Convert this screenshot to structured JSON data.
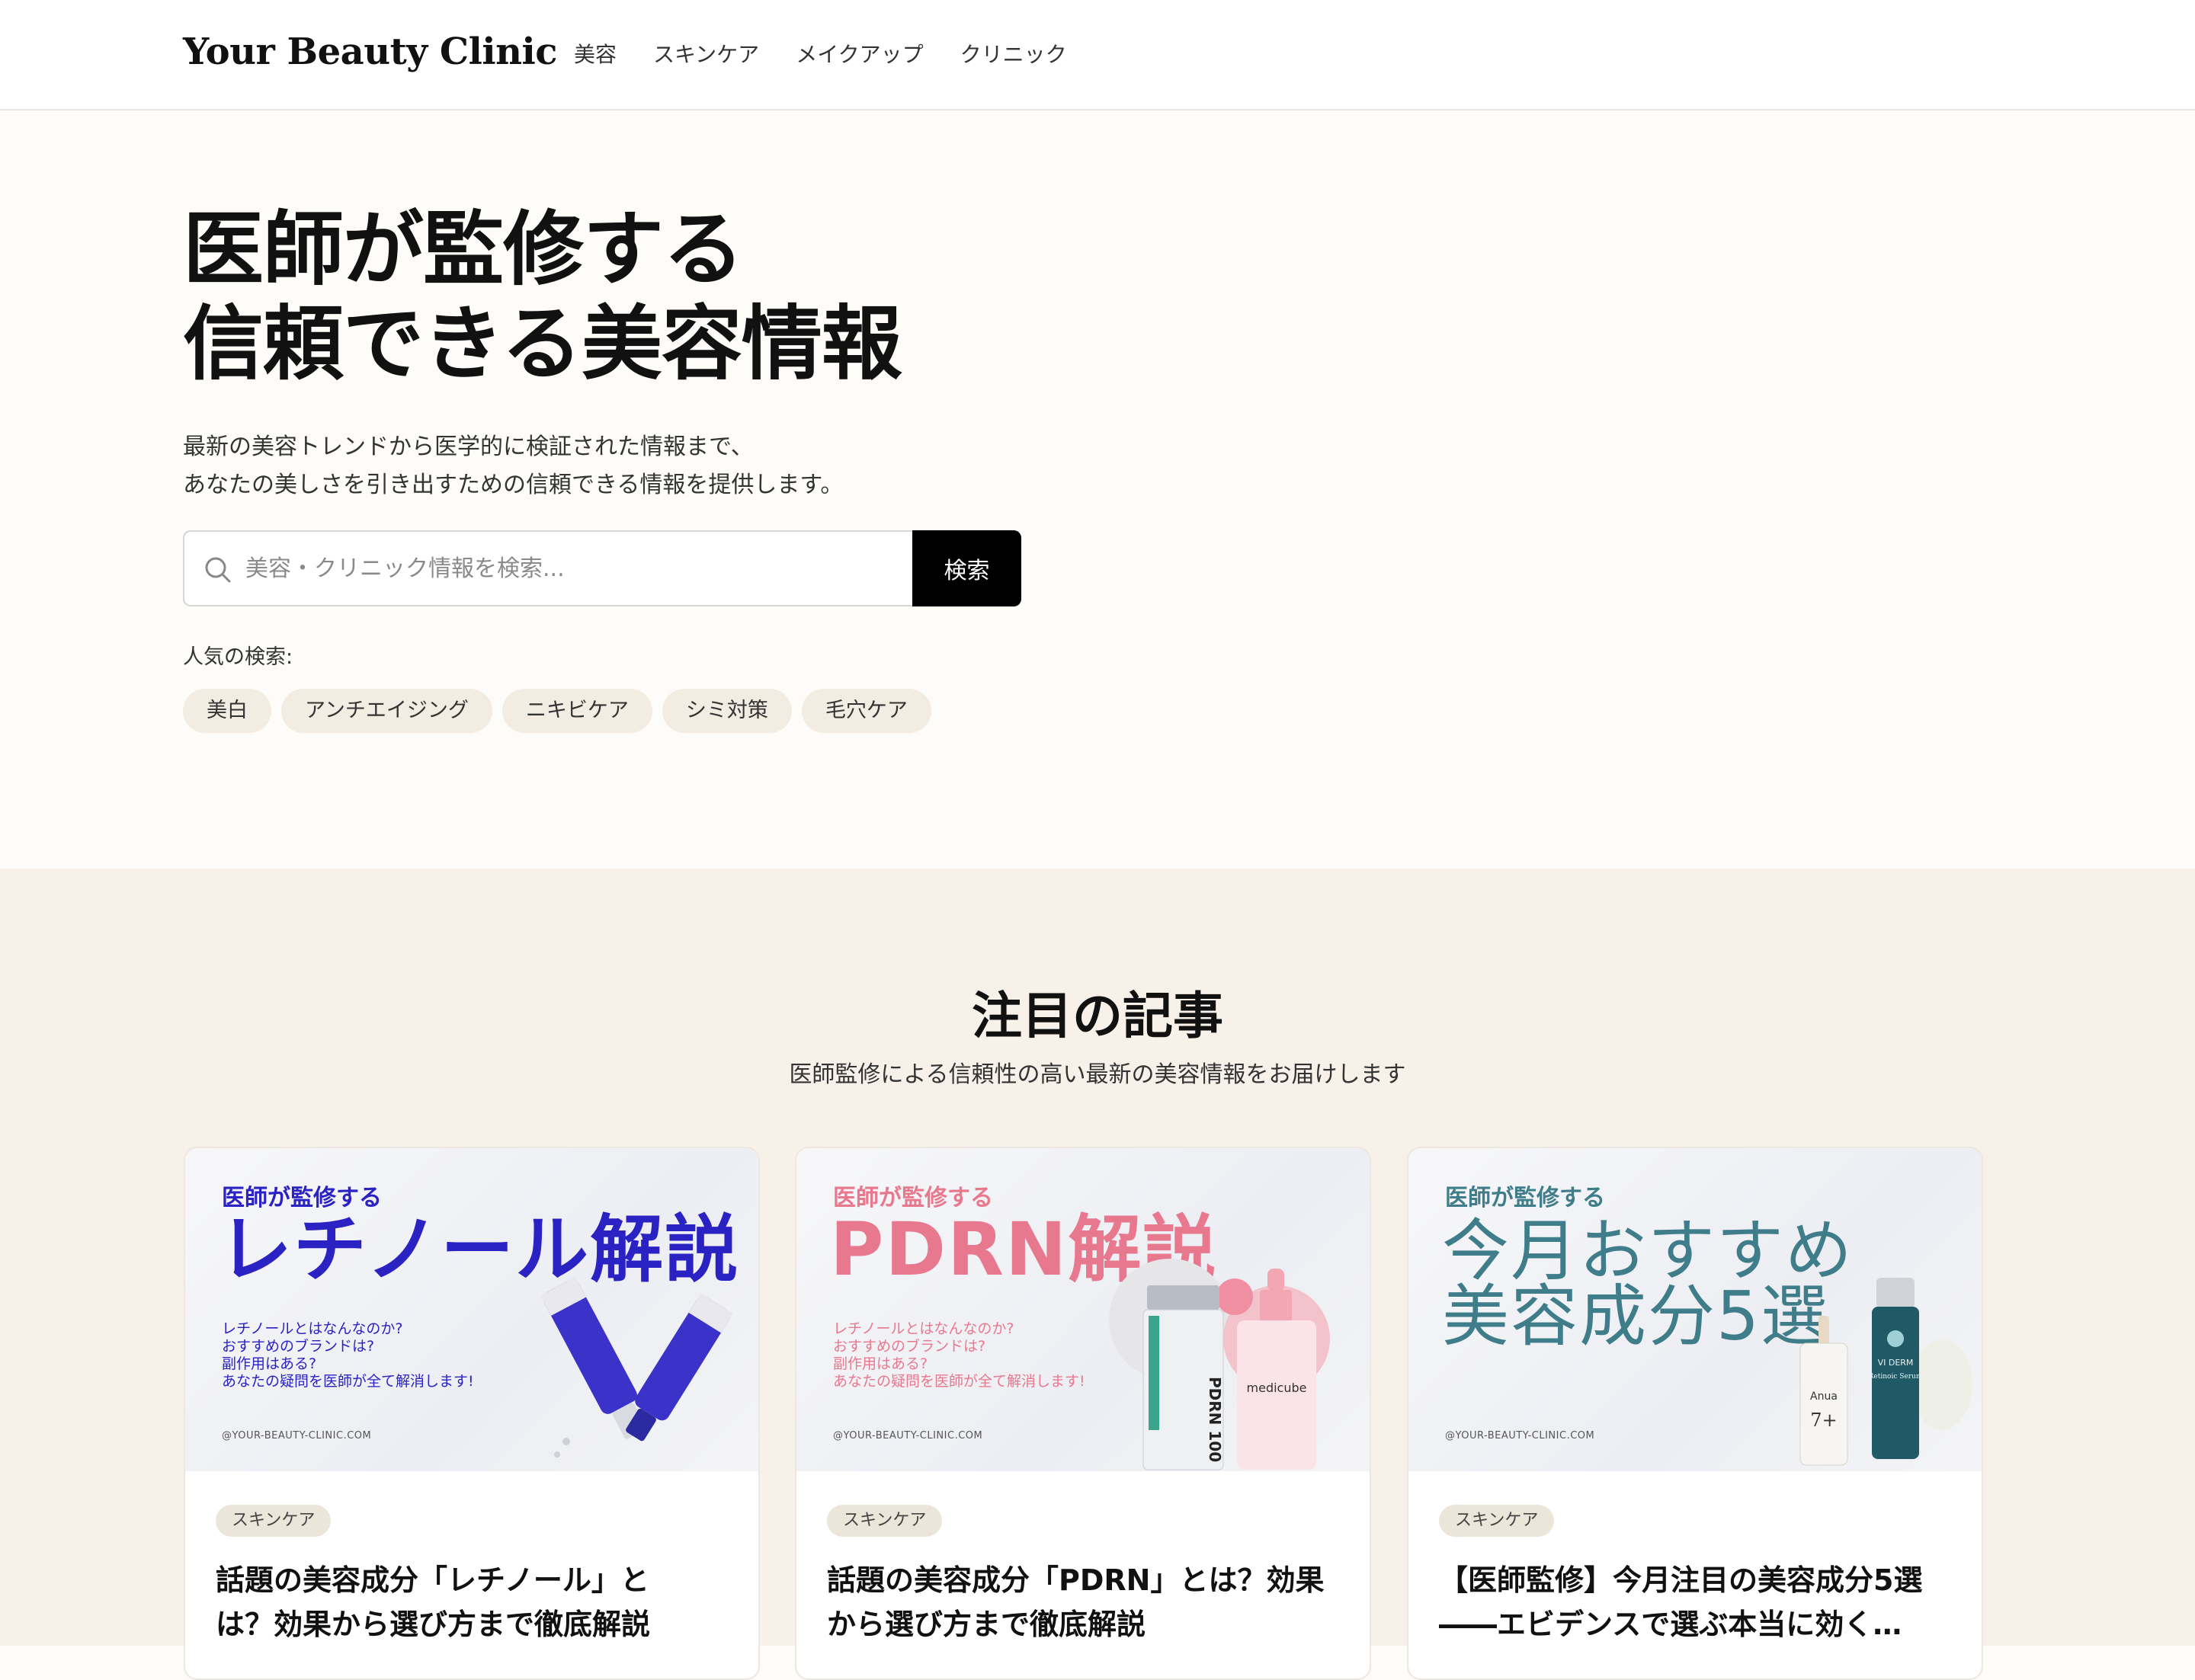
{
  "header": {
    "logo": "Your Beauty Clinic",
    "nav": [
      "美容",
      "スキンケア",
      "メイクアップ",
      "クリニック"
    ]
  },
  "hero": {
    "title_line1": "医師が監修する",
    "title_line2": "信頼できる美容情報",
    "desc_line1": "最新の美容トレンドから医学的に検証された情報まで、",
    "desc_line2": "あなたの美しさを引き出すための信頼できる情報を提供します。",
    "search": {
      "placeholder": "美容・クリニック情報を検索...",
      "value": "",
      "button": "検索",
      "icon": "search-icon"
    },
    "popular_label": "人気の検索:",
    "popular_tags": [
      "美白",
      "アンチエイジング",
      "ニキビケア",
      "シミ対策",
      "毛穴ケア"
    ]
  },
  "featured": {
    "title": "注目の記事",
    "subtitle": "医師監修による信頼性の高い最新の美容情報をお届けします",
    "cards": [
      {
        "image": {
          "overline": "医師が監修する",
          "headline": "レチノール解説",
          "lines": "レチノールとはなんなのか?\nおすすめのブランドは?\n副作用はある?\nあなたの疑問を医師が全て解消します!",
          "url": "@YOUR-BEAUTY-CLINIC.COM",
          "accent": "#2b22c4"
        },
        "category": "スキンケア",
        "title_line1": "話題の美容成分「レチノール」と",
        "title_line2": "は？効果から選び方まで徹底解説"
      },
      {
        "image": {
          "overline": "医師が監修する",
          "headline": "PDRN解説",
          "lines": "レチノールとはなんなのか?\nおすすめのブランドは?\n副作用はある?\nあなたの疑問を医師が全て解消します!",
          "url": "@YOUR-BEAUTY-CLINIC.COM",
          "accent": "#e8788e",
          "product_labels": [
            "PDRN 100",
            "medicube"
          ]
        },
        "category": "スキンケア",
        "title_line1": "話題の美容成分「PDRN」とは？効果",
        "title_line2": "から選び方まで徹底解説"
      },
      {
        "image": {
          "overline": "医師が監修する",
          "headline_line1": "今月おすすめ",
          "headline_line2": "美容成分5選",
          "url": "@YOUR-BEAUTY-CLINIC.COM",
          "accent": "#3f7d8a",
          "product_labels": [
            "Anua",
            "7+",
            "VI DERM",
            "Retinoic Serum"
          ]
        },
        "category": "スキンケア",
        "title_line1": "【医師監修】今月注目の美容成分5選",
        "title_line2": "――エビデンスで選ぶ本当に効く…"
      }
    ]
  }
}
